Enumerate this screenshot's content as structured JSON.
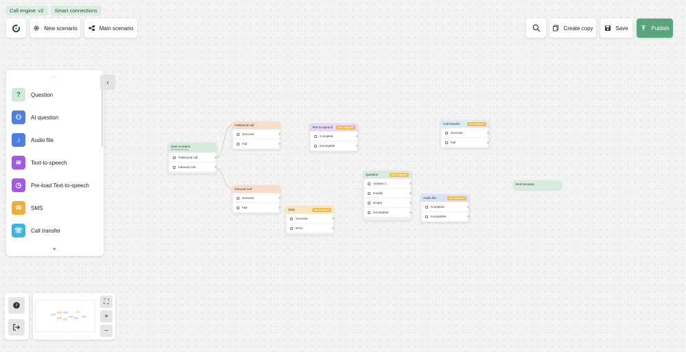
{
  "header": {
    "chips": [
      "Call engine: v2",
      "Smart connections"
    ],
    "new_scenario": "New scenario",
    "main_scenario": "Main scenario",
    "create_copy": "Create copy",
    "save": "Save",
    "publish": "Publish"
  },
  "palette": {
    "items": [
      {
        "label": "Question",
        "color": "#5ec28e",
        "icon": "question-icon"
      },
      {
        "label": "AI question",
        "color": "#4e7fe0",
        "icon": "ai-icon"
      },
      {
        "label": "Audio file",
        "color": "#4f7de8",
        "icon": "music-icon"
      },
      {
        "label": "Text-to-speech",
        "color": "#a259e6",
        "icon": "waveform-icon"
      },
      {
        "label": "Pre-load Text-to-speech",
        "color": "#a259e6",
        "icon": "clock-icon"
      },
      {
        "label": "SMS",
        "color": "#f2ac3a",
        "icon": "mail-icon"
      },
      {
        "label": "Call transfer",
        "color": "#36b7e0",
        "icon": "phone-transfer-icon"
      }
    ]
  },
  "nodes": {
    "start": {
      "title": "Start scenario",
      "subtitle": "General settings",
      "rows": [
        "Outbound call",
        "Inbound call"
      ]
    },
    "outbound": {
      "title": "Outbound call",
      "rows": [
        "Success",
        "Fail"
      ]
    },
    "inbound": {
      "title": "Inbound call",
      "rows": [
        "Success",
        "Fail"
      ]
    },
    "tts": {
      "title": "Text-to-speech",
      "tag": "Not configured",
      "rows": [
        "Complete",
        "Incomplete"
      ]
    },
    "sms": {
      "title": "SMS",
      "tag": "Not configured",
      "rows": [
        "Success",
        "Error"
      ]
    },
    "question": {
      "title": "Question",
      "tag": "Not configured",
      "rows": [
        "Answer 1",
        "Invalid",
        "Empty",
        "Incomplete"
      ]
    },
    "audio": {
      "title": "Audio file",
      "tag": "Not configured",
      "rows": [
        "Complete",
        "Incomplete"
      ]
    },
    "transfer": {
      "title": "Call transfer",
      "tag": "Not configured",
      "rows": [
        "Success",
        "Fail"
      ]
    },
    "end": {
      "title": "End scenario"
    }
  }
}
